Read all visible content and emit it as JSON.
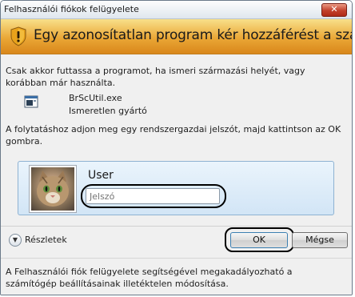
{
  "window": {
    "title": "Felhasználói fiókok felügyelete",
    "close_label": "✕"
  },
  "banner": {
    "heading": "Egy azonosítatlan program kér hozzáférést a számítógéphez",
    "icon": "shield-warning-icon"
  },
  "body": {
    "intro": "Csak akkor futtassa a programot, ha ismeri származási helyét, vagy korábban már használta.",
    "program_name": "BrScUtil.exe",
    "publisher": "Ismeretlen gyártó",
    "instruction": "A folytatáshoz adjon meg egy rendszergazdai jelszót, majd kattintson az OK gombra."
  },
  "credentials": {
    "username": "User",
    "password_placeholder": "Jelszó",
    "avatar_icon": "cat-avatar"
  },
  "actions": {
    "details_label": "Részletek",
    "ok_label": "OK",
    "cancel_label": "Mégse"
  },
  "footer": {
    "text": "A Felhasználói fiók felügyelete segítségével megakadályozható a számítógép beállításainak illetéktelen módosítása."
  },
  "colors": {
    "banner_top": "#f8e08a",
    "banner_bottom": "#d9871b",
    "close_button": "#c2402b",
    "credential_box": "#d2e5f6"
  }
}
